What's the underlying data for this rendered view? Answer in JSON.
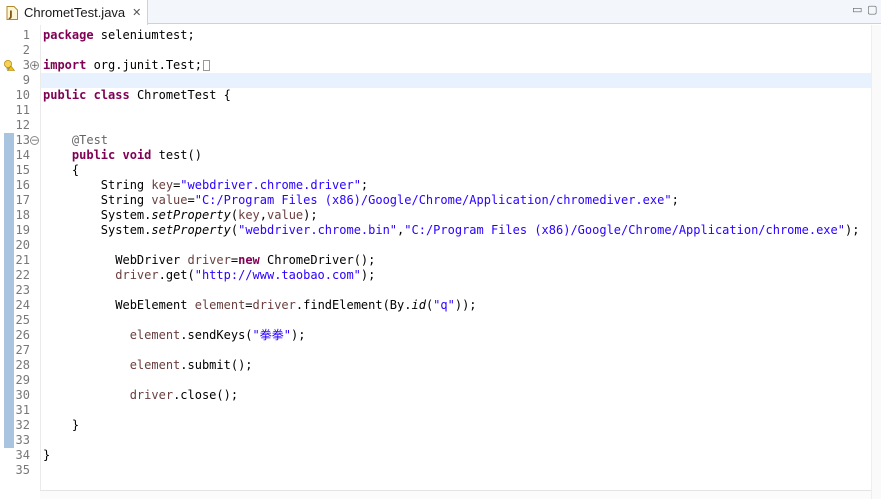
{
  "tab": {
    "title": "ChrometTest.java",
    "close_glyph": "✕"
  },
  "window_controls": {
    "minimize": "▭",
    "maximize": "▢"
  },
  "lines": [
    {
      "n": "1",
      "tokens": [
        {
          "t": "package",
          "c": "kw"
        },
        {
          "t": " seleniumtest;"
        }
      ]
    },
    {
      "n": "2",
      "tokens": []
    },
    {
      "n": "3",
      "tokens": [
        {
          "t": "import",
          "c": "kw"
        },
        {
          "t": " org.junit.Test;"
        }
      ]
    },
    {
      "n": "9",
      "tokens": []
    },
    {
      "n": "10",
      "tokens": [
        {
          "t": "public",
          "c": "kw"
        },
        {
          "t": " "
        },
        {
          "t": "class",
          "c": "kw"
        },
        {
          "t": " ChrometTest {"
        }
      ]
    },
    {
      "n": "11",
      "tokens": []
    },
    {
      "n": "12",
      "tokens": []
    },
    {
      "n": "13",
      "tokens": [
        {
          "t": "    "
        },
        {
          "t": "@Test",
          "c": "ann"
        }
      ]
    },
    {
      "n": "14",
      "tokens": [
        {
          "t": "    "
        },
        {
          "t": "public",
          "c": "kw"
        },
        {
          "t": " "
        },
        {
          "t": "void",
          "c": "kw"
        },
        {
          "t": " test()"
        }
      ]
    },
    {
      "n": "15",
      "tokens": [
        {
          "t": "    {"
        }
      ]
    },
    {
      "n": "16",
      "tokens": [
        {
          "t": "        String "
        },
        {
          "t": "key",
          "c": "var"
        },
        {
          "t": "="
        },
        {
          "t": "\"webdriver.chrome.driver\"",
          "c": "str"
        },
        {
          "t": ";"
        }
      ]
    },
    {
      "n": "17",
      "tokens": [
        {
          "t": "        String "
        },
        {
          "t": "value",
          "c": "var"
        },
        {
          "t": "="
        },
        {
          "t": "\"C:/Program Files (x86)/Google/Chrome/Application/chromediver.exe\"",
          "c": "str"
        },
        {
          "t": ";"
        }
      ]
    },
    {
      "n": "18",
      "tokens": [
        {
          "t": "        System."
        },
        {
          "t": "setProperty",
          "c": "itl"
        },
        {
          "t": "("
        },
        {
          "t": "key",
          "c": "var"
        },
        {
          "t": ","
        },
        {
          "t": "value",
          "c": "var"
        },
        {
          "t": ");"
        }
      ]
    },
    {
      "n": "19",
      "tokens": [
        {
          "t": "        System."
        },
        {
          "t": "setProperty",
          "c": "itl"
        },
        {
          "t": "("
        },
        {
          "t": "\"webdriver.chrome.bin\"",
          "c": "str"
        },
        {
          "t": ","
        },
        {
          "t": "\"C:/Program Files (x86)/Google/Chrome/Application/chrome.exe\"",
          "c": "str"
        },
        {
          "t": ");"
        }
      ]
    },
    {
      "n": "20",
      "tokens": []
    },
    {
      "n": "21",
      "tokens": [
        {
          "t": "          WebDriver "
        },
        {
          "t": "driver",
          "c": "var"
        },
        {
          "t": "="
        },
        {
          "t": "new",
          "c": "kw"
        },
        {
          "t": " ChromeDriver();"
        }
      ]
    },
    {
      "n": "22",
      "tokens": [
        {
          "t": "          "
        },
        {
          "t": "driver",
          "c": "var"
        },
        {
          "t": ".get("
        },
        {
          "t": "\"http://www.taobao.com\"",
          "c": "str"
        },
        {
          "t": ");"
        }
      ]
    },
    {
      "n": "23",
      "tokens": []
    },
    {
      "n": "24",
      "tokens": [
        {
          "t": "          WebElement "
        },
        {
          "t": "element",
          "c": "var"
        },
        {
          "t": "="
        },
        {
          "t": "driver",
          "c": "var"
        },
        {
          "t": ".findElement(By."
        },
        {
          "t": "id",
          "c": "itl"
        },
        {
          "t": "("
        },
        {
          "t": "\"q\"",
          "c": "str"
        },
        {
          "t": "));"
        }
      ]
    },
    {
      "n": "25",
      "tokens": []
    },
    {
      "n": "26",
      "tokens": [
        {
          "t": "            "
        },
        {
          "t": "element",
          "c": "var"
        },
        {
          "t": ".sendKeys("
        },
        {
          "t": "\"拳拳\"",
          "c": "str"
        },
        {
          "t": ");"
        }
      ]
    },
    {
      "n": "27",
      "tokens": []
    },
    {
      "n": "28",
      "tokens": [
        {
          "t": "            "
        },
        {
          "t": "element",
          "c": "var"
        },
        {
          "t": ".submit();"
        }
      ]
    },
    {
      "n": "29",
      "tokens": []
    },
    {
      "n": "30",
      "tokens": [
        {
          "t": "            "
        },
        {
          "t": "driver",
          "c": "var"
        },
        {
          "t": ".close();"
        }
      ]
    },
    {
      "n": "31",
      "tokens": []
    },
    {
      "n": "32",
      "tokens": [
        {
          "t": "    }"
        }
      ]
    },
    {
      "n": "33",
      "tokens": []
    },
    {
      "n": "34",
      "tokens": [
        {
          "t": "}"
        }
      ]
    },
    {
      "n": "35",
      "tokens": []
    }
  ],
  "folds": {
    "collapsed": "+",
    "expanded": "−"
  },
  "colors": {
    "keyword": "#7f0055",
    "string": "#2a00ff",
    "annotation": "#646464",
    "local_var": "#6a3e3e",
    "current_line": "#e8f2fe"
  },
  "icons": {
    "tab_file": "java-file-icon",
    "warning_marker": "lightbulb-warning-icon"
  }
}
